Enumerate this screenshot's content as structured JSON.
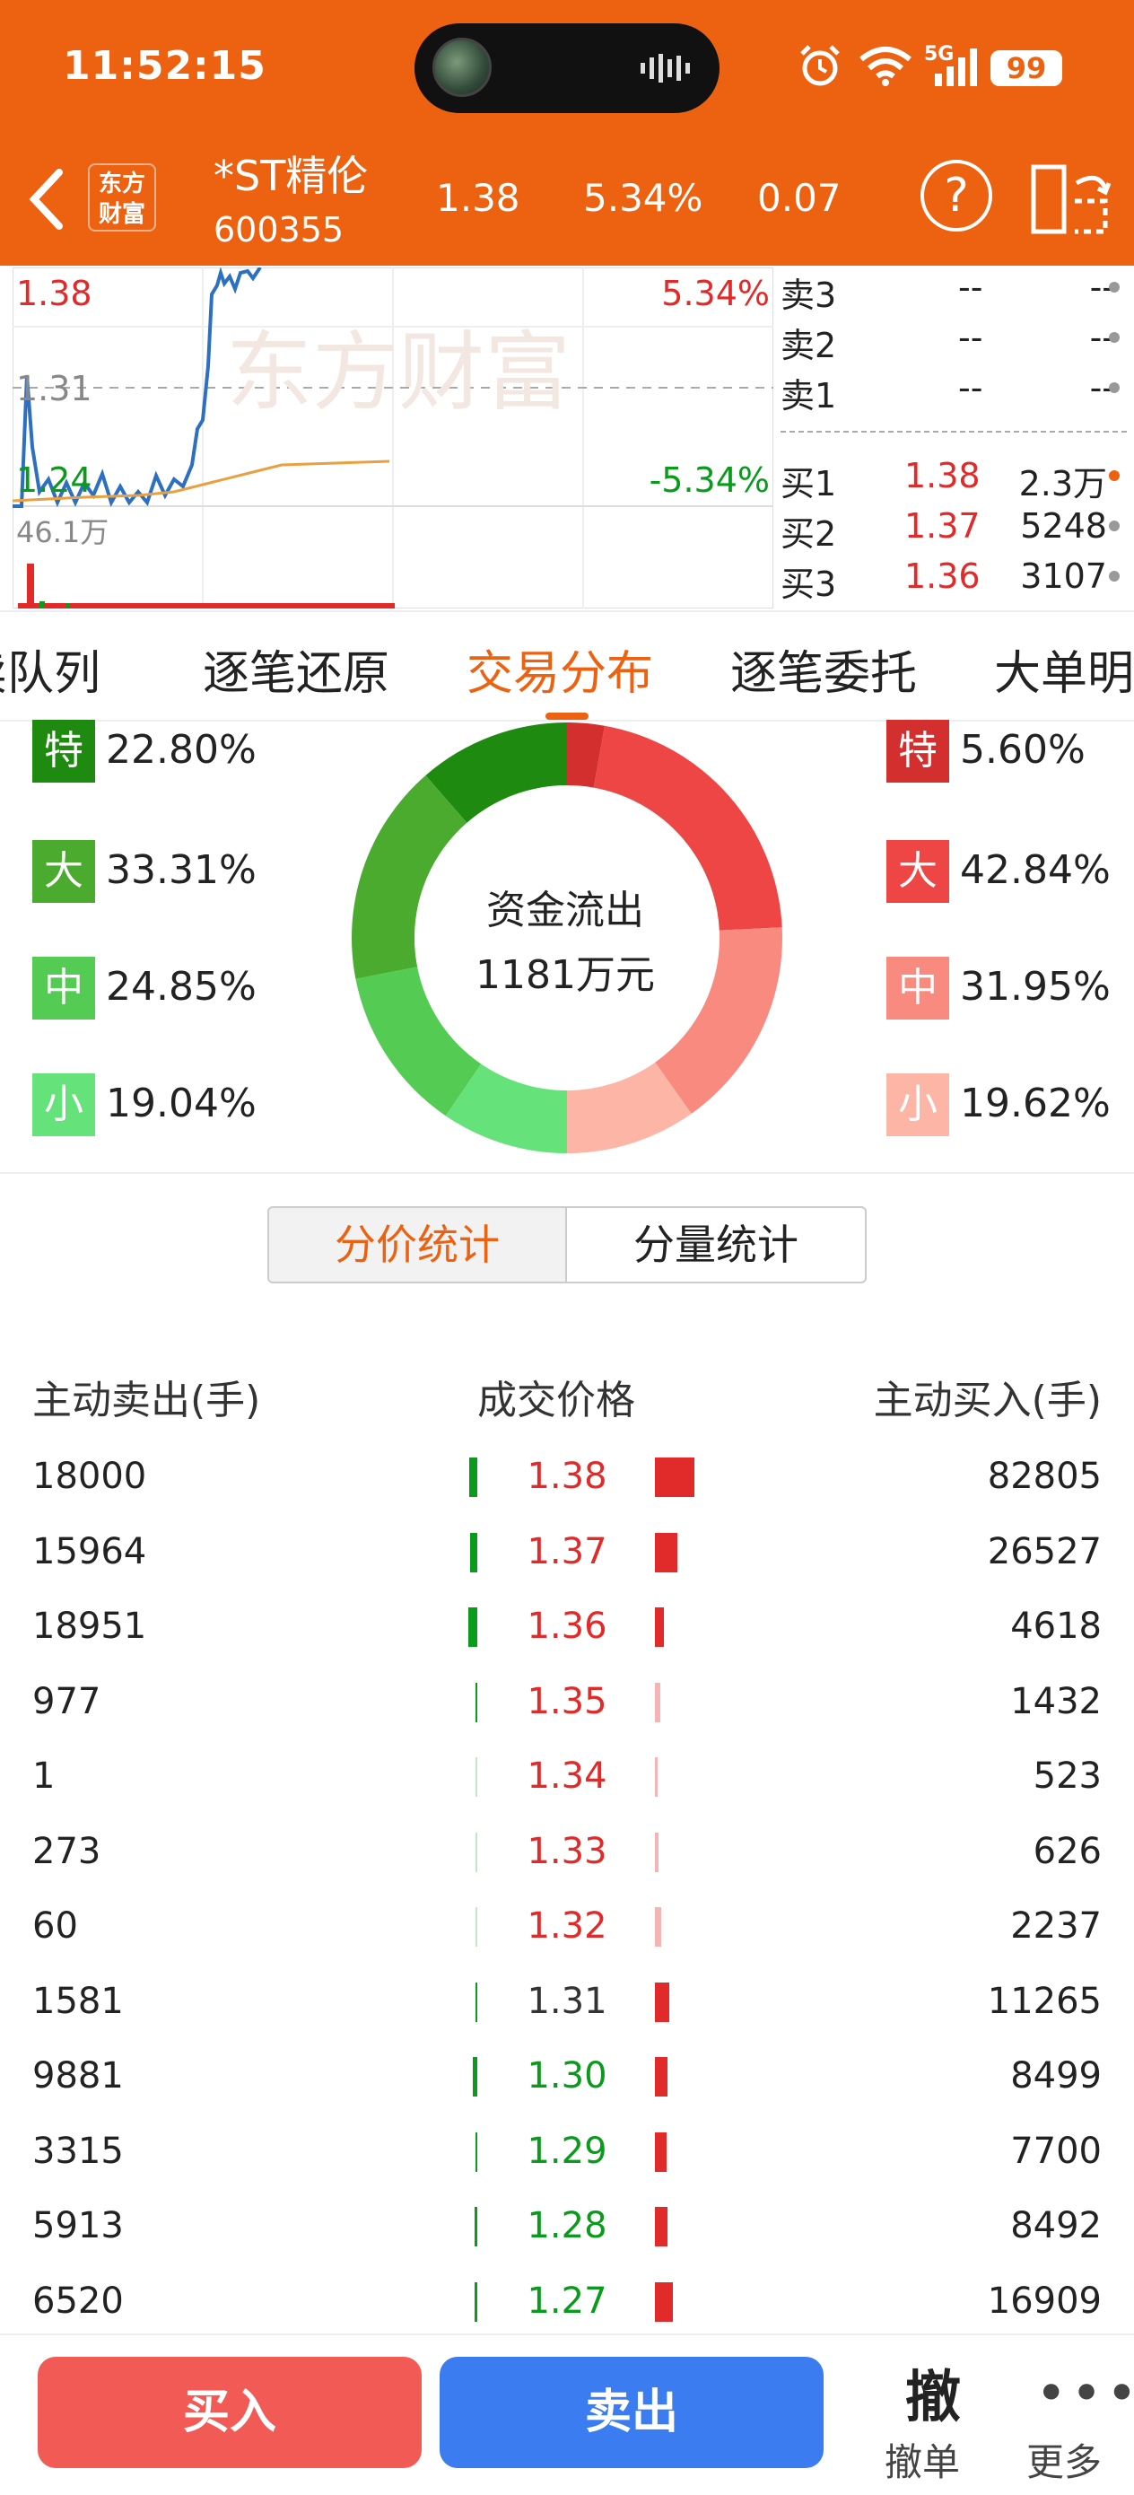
{
  "status": {
    "time": "11:52:15",
    "battery": "99",
    "network": "5G"
  },
  "header": {
    "logo_line1": "东方",
    "logo_line2": "财富",
    "name": "*ST精伦",
    "code": "600355",
    "price": "1.38",
    "change_pct": "5.34%",
    "change": "0.07",
    "help": "?"
  },
  "chart": {
    "high": "1.38",
    "mid": "1.31",
    "low": "1.24",
    "high_pct": "5.34%",
    "low_pct": "-5.34%",
    "volume": "46.1万",
    "watermark": "东方财富"
  },
  "orderbook": {
    "asks": [
      {
        "label": "卖3",
        "price": "--",
        "vol": "--"
      },
      {
        "label": "卖2",
        "price": "--",
        "vol": "--"
      },
      {
        "label": "卖1",
        "price": "--",
        "vol": "--"
      }
    ],
    "bids": [
      {
        "label": "买1",
        "price": "1.38",
        "vol": "2.3万"
      },
      {
        "label": "买2",
        "price": "1.37",
        "vol": "5248"
      },
      {
        "label": "买3",
        "price": "1.36",
        "vol": "3107"
      }
    ]
  },
  "tabs": [
    "卖队列",
    "逐笔还原",
    "交易分布",
    "逐笔委托",
    "大单明"
  ],
  "active_tab": "交易分布",
  "distribution": {
    "center_line1": "资金流出",
    "center_line2": "1181万元",
    "outflow": [
      {
        "tag": "特",
        "pct": "22.80%",
        "color": "#1e8a0f"
      },
      {
        "tag": "大",
        "pct": "33.31%",
        "color": "#4aab2e"
      },
      {
        "tag": "中",
        "pct": "24.85%",
        "color": "#54cc54"
      },
      {
        "tag": "小",
        "pct": "19.04%",
        "color": "#66e27a"
      }
    ],
    "inflow": [
      {
        "tag": "特",
        "pct": "5.60%",
        "color": "#d32f2f"
      },
      {
        "tag": "大",
        "pct": "42.84%",
        "color": "#ee4545"
      },
      {
        "tag": "中",
        "pct": "31.95%",
        "color": "#f98a80"
      },
      {
        "tag": "小",
        "pct": "19.62%",
        "color": "#fdb5a6"
      }
    ]
  },
  "segments": {
    "price": "分价统计",
    "volume": "分量统计"
  },
  "table": {
    "headers": {
      "sell": "主动卖出(手)",
      "price": "成交价格",
      "buy": "主动买入(手)"
    },
    "rows": [
      {
        "sell": "18000",
        "price": "1.38",
        "buy": "82805",
        "pcolor": "red"
      },
      {
        "sell": "15964",
        "price": "1.37",
        "buy": "26527",
        "pcolor": "red"
      },
      {
        "sell": "18951",
        "price": "1.36",
        "buy": "4618",
        "pcolor": "red"
      },
      {
        "sell": "977",
        "price": "1.35",
        "buy": "1432",
        "pcolor": "red"
      },
      {
        "sell": "1",
        "price": "1.34",
        "buy": "523",
        "pcolor": "red"
      },
      {
        "sell": "273",
        "price": "1.33",
        "buy": "626",
        "pcolor": "red"
      },
      {
        "sell": "60",
        "price": "1.32",
        "buy": "2237",
        "pcolor": "red"
      },
      {
        "sell": "1581",
        "price": "1.31",
        "buy": "11265",
        "pcolor": "gray"
      },
      {
        "sell": "9881",
        "price": "1.30",
        "buy": "8499",
        "pcolor": "green"
      },
      {
        "sell": "3315",
        "price": "1.29",
        "buy": "7700",
        "pcolor": "green"
      },
      {
        "sell": "5913",
        "price": "1.28",
        "buy": "8492",
        "pcolor": "green"
      },
      {
        "sell": "6520",
        "price": "1.27",
        "buy": "16909",
        "pcolor": "green"
      }
    ]
  },
  "bottom": {
    "buy": "买入",
    "sell": "卖出",
    "cancel_icon": "撤",
    "cancel": "撤单",
    "more": "更多"
  }
}
